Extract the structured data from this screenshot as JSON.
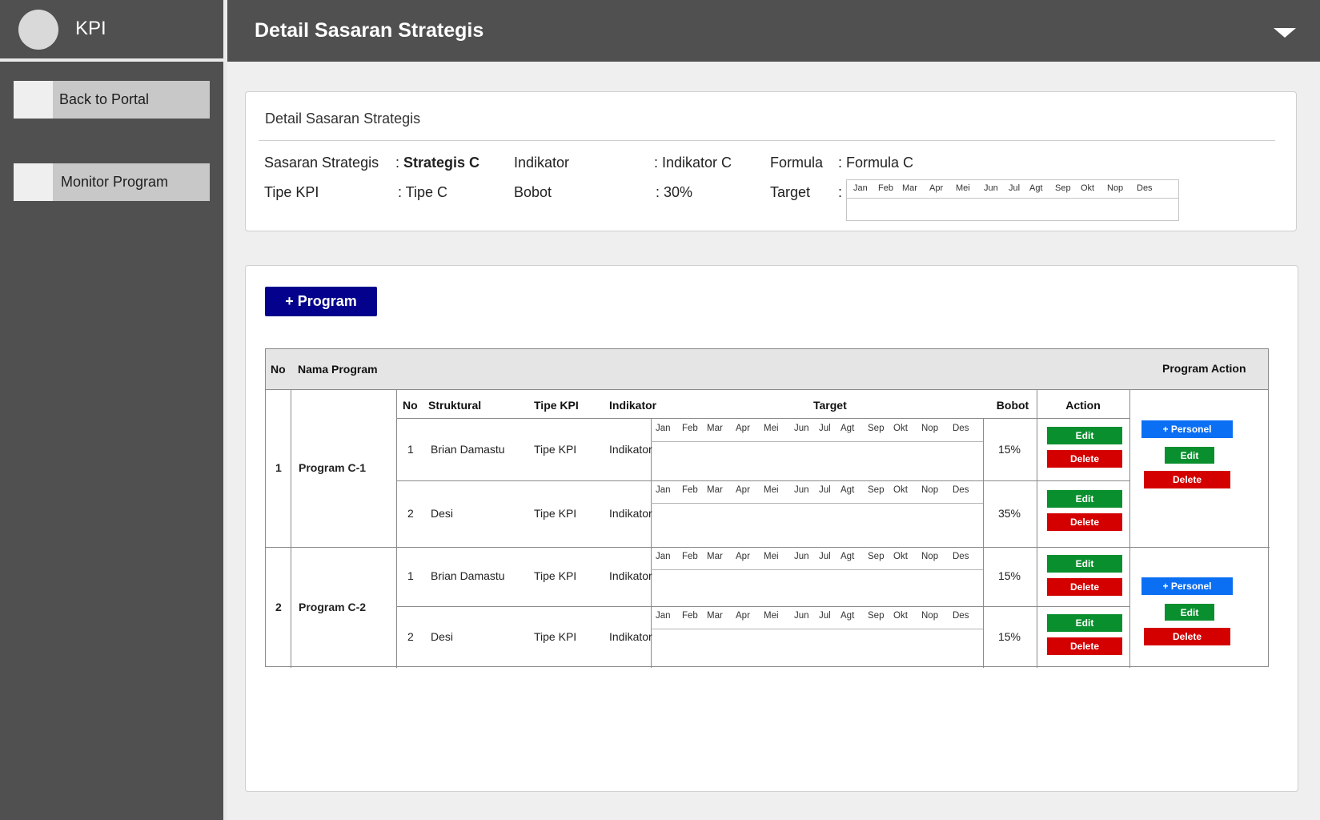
{
  "app": {
    "name": "KPI"
  },
  "sidebar": {
    "items": [
      {
        "label": "Back to Portal"
      },
      {
        "label": "Monitor Program"
      }
    ]
  },
  "header": {
    "title": "Detail Sasaran Strategis"
  },
  "detail": {
    "card_title": "Detail Sasaran Strategis",
    "sasaran_label": "Sasaran Strategis",
    "sasaran_value": "Strategis C",
    "indikator_label": "Indikator",
    "indikator_value": ": Indikator C",
    "formula_label": "Formula",
    "formula_value": ": Formula C",
    "tipe_label": "Tipe KPI",
    "tipe_value": ": Tipe C",
    "bobot_label": "Bobot",
    "bobot_value": ": 30%",
    "target_label": "Target",
    "colon": ":"
  },
  "months": [
    "Jan",
    "Feb",
    "Mar",
    "Apr",
    "Mei",
    "Jun",
    "Jul",
    "Agt",
    "Sep",
    "Okt",
    "Nop",
    "Des"
  ],
  "program_section": {
    "add_button": "+ Program",
    "table": {
      "headers": {
        "no": "No",
        "nama_program": "Nama Program",
        "program_action": "Program Action"
      },
      "sub_headers": {
        "no": "No",
        "struktural": "Struktural",
        "tipe_kpi": "Tipe KPI",
        "indikator": "Indikator",
        "target": "Target",
        "bobot": "Bobot",
        "action": "Action"
      },
      "programs": [
        {
          "no": "1",
          "name": "Program C-1",
          "rows": [
            {
              "no": "1",
              "struktural": "Brian Damastu",
              "tipe_kpi": "Tipe KPI",
              "indikator": "Indikator",
              "bobot": "15%"
            },
            {
              "no": "2",
              "struktural": "Desi",
              "tipe_kpi": "Tipe KPI",
              "indikator": "Indikator",
              "bobot": "35%"
            }
          ]
        },
        {
          "no": "2",
          "name": "Program C-2",
          "rows": [
            {
              "no": "1",
              "struktural": "Brian Damastu",
              "tipe_kpi": "Tipe KPI",
              "indikator": "Indikator",
              "bobot": "15%"
            },
            {
              "no": "2",
              "struktural": "Desi",
              "tipe_kpi": "Tipe KPI",
              "indikator": "Indikator",
              "bobot": "15%"
            }
          ]
        }
      ],
      "buttons": {
        "edit": "Edit",
        "delete": "Delete",
        "personel": "+ Personel"
      }
    }
  },
  "colors": {
    "sidebar_bg": "#505050",
    "primary_button": "#04028c",
    "edit": "#0a8f2f",
    "delete": "#d40000",
    "personel": "#0b6ff3"
  }
}
